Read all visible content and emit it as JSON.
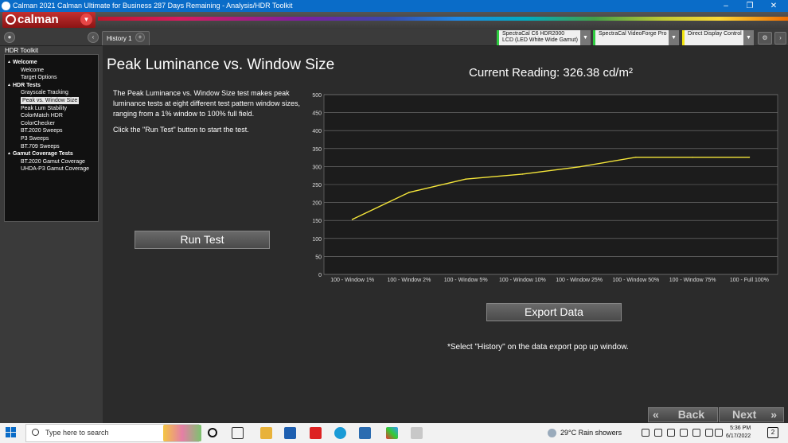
{
  "window": {
    "title": "Calman 2021 Calman Ultimate for Business 287 Days Remaining  - Analysis/HDR Toolkit",
    "min": "–",
    "max": "❐",
    "close": "✕"
  },
  "logo": {
    "text": "calman",
    "dropdown": "▼"
  },
  "toolbar": {
    "back_glyph": "‹",
    "tab": "History 1",
    "add_tab": "+"
  },
  "devices": [
    {
      "line1": "SpectraCal C6 HDR2000",
      "line2": "LCD (LED White Wide Gamut)",
      "color": "#2ecc40"
    },
    {
      "line1": "SpectraCal VideoForge Pro",
      "line2": "",
      "color": "#2ecc40"
    },
    {
      "line1": "Direct Display Control",
      "line2": "",
      "color": "#f1e40f"
    }
  ],
  "sidebar": {
    "header": "HDR Toolkit",
    "items": [
      {
        "label": "Welcome",
        "type": "section"
      },
      {
        "label": "Welcome",
        "type": "item"
      },
      {
        "label": "Target Options",
        "type": "item"
      },
      {
        "label": "HDR Tests",
        "type": "section"
      },
      {
        "label": "Grayscale Tracking",
        "type": "item"
      },
      {
        "label": "Peak vs. Window Size",
        "type": "selected"
      },
      {
        "label": "Peak Lum Stability",
        "type": "item"
      },
      {
        "label": "ColorMatch HDR",
        "type": "item"
      },
      {
        "label": "ColorChecker",
        "type": "item"
      },
      {
        "label": "BT.2020 Sweeps",
        "type": "item"
      },
      {
        "label": "P3 Sweeps",
        "type": "item"
      },
      {
        "label": "BT.709 Sweeps",
        "type": "item"
      },
      {
        "label": "Gamut Coverage Tests",
        "type": "section"
      },
      {
        "label": "BT.2020 Gamut Coverage",
        "type": "item"
      },
      {
        "label": "UHDA-P3 Gamut Coverage",
        "type": "item"
      }
    ]
  },
  "main": {
    "title": "Peak Luminance vs. Window Size",
    "reading": "Current Reading: 326.38 cd/m²",
    "desc1": "The Peak Luminance vs. Window Size test makes peak luminance tests at eight different test pattern window sizes, ranging from a 1% window to 100% full field.",
    "desc2": "Click the \"Run Test\" button to start the test.",
    "run_button": "Run Test",
    "export_button": "Export  Data",
    "note": "*Select \"History\" on the data export pop up window.",
    "back": "Back",
    "next": "Next"
  },
  "chart_data": {
    "type": "line",
    "categories": [
      "100 - Window  1%",
      "100 - Window  2%",
      "100 - Window  5%",
      "100 - Window 10%",
      "100 - Window 25%",
      "100 - Window 50%",
      "100 - Window 75%",
      "100 - Full  100%"
    ],
    "series": [
      {
        "values": [
          153,
          228,
          265,
          279,
          299,
          326,
          326,
          326
        ],
        "color": "#f5e63a"
      }
    ],
    "yticks": [
      0,
      50,
      100,
      150,
      200,
      250,
      300,
      350,
      400,
      450,
      500
    ],
    "ylim": [
      0,
      500
    ],
    "grid": true,
    "title": "",
    "xlabel": "",
    "ylabel": ""
  },
  "taskbar": {
    "search_placeholder": "Type here to search",
    "weather": "29°C  Rain showers",
    "time": "5:36 PM",
    "date": "6/17/2022",
    "notif": "2"
  }
}
